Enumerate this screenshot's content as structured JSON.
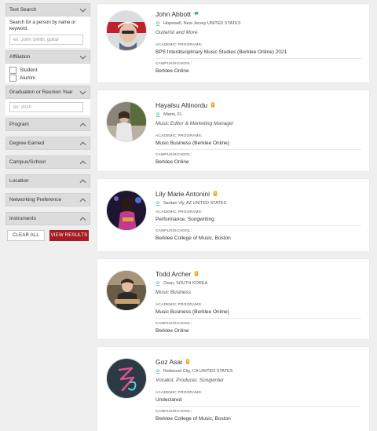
{
  "sidebar": {
    "text_search": {
      "title": "Text Search",
      "help": "Search for a person by name or keyword.",
      "placeholder": "ex: John Smith, guitar"
    },
    "affiliation": {
      "title": "Affiliation",
      "options": [
        "Student",
        "Alumni"
      ]
    },
    "graduation": {
      "title": "Graduation or Reunion Year",
      "placeholder": "ex: 2020"
    },
    "facets": [
      "Program",
      "Degree Earned",
      "Campus/School",
      "Location",
      "Networking Preference",
      "Instruments"
    ],
    "clear_label": "CLEAR ALL",
    "view_label": "VIEW RESULTS"
  },
  "labels": {
    "programs": "ACADEMIC PROGRAMS:",
    "campus": "CAMPUS/SCHOOL:"
  },
  "colors": {
    "accent_red": "#a51c24",
    "badge_orange": "#f0a020",
    "badge_teal": "#3aa89c",
    "pin_teal": "#5fb0a8"
  },
  "people": [
    {
      "name": "John Abbott",
      "badge_icon": "chat-bubble-icon",
      "location": "Hopewell, New Jersey UNITED STATES",
      "tagline": "Guitarist and More",
      "program": "BPS Interdisciplinary Music Studies (Berklee Online) 2021",
      "campus": "Berklee Online"
    },
    {
      "name": "Hayalsu Altinordu",
      "badge_icon": "award-icon",
      "location": "Miami, FL",
      "tagline": "Music Editor & Marketing Manager",
      "program": "Music Business (Berklee Online)",
      "campus": "Berklee Online"
    },
    {
      "name": "Lily Marie Antonini",
      "badge_icon": "award-icon",
      "location": "Santan Vly, AZ UNITED STATES",
      "tagline": "",
      "program": "Performance, Songwriting",
      "campus": "Berklee College of Music, Boston"
    },
    {
      "name": "Todd Archer",
      "badge_icon": "award-icon",
      "location": "Osan, SOUTH KOREA",
      "tagline": "Music Business",
      "program": "Music Business (Berklee Online)",
      "campus": "Berklee Online"
    },
    {
      "name": "Goz Asai",
      "badge_icon": "award-icon",
      "location": "Redwood City, CA UNITED STATES",
      "tagline": "Vocalist, Producer, Songwriter",
      "program": "Undeclared",
      "campus": "Berklee College of Music, Boston"
    }
  ]
}
